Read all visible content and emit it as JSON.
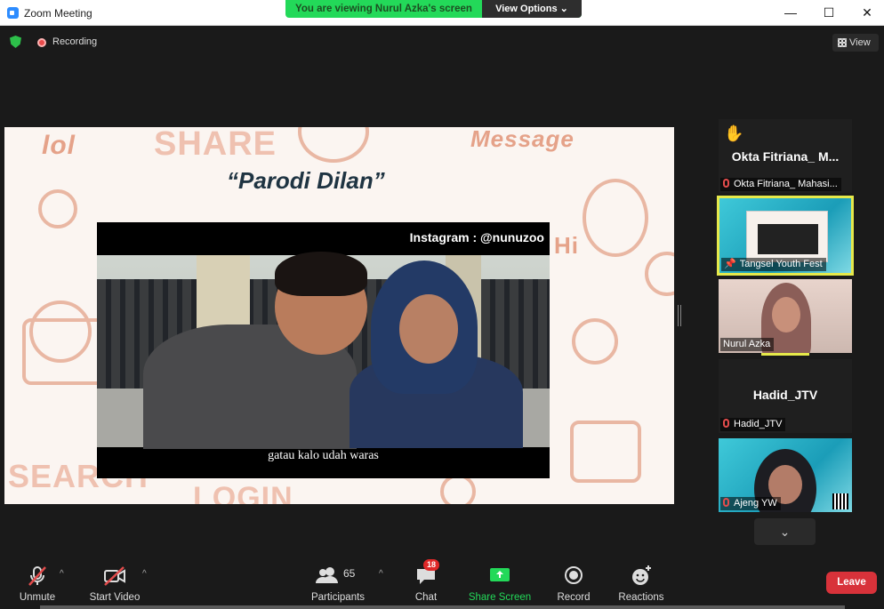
{
  "window": {
    "title": "Zoom Meeting"
  },
  "banner": {
    "text": "You are viewing Nurul Azka's screen",
    "options_label": "View Options"
  },
  "status": {
    "recording_label": "Recording",
    "view_label": "View"
  },
  "shared_screen": {
    "slide_title": "“Parodi Dilan”",
    "instagram": "Instagram : @nunuzoo",
    "caption": "gatau kalo udah waras",
    "doodles": [
      "lol",
      "SHARE",
      "Message",
      "Hi",
      "SEARCH",
      "LOGIN"
    ]
  },
  "participants": [
    {
      "display_name": "Okta  Fitriana_  M...",
      "label": "Okta Fitriana_ Mahasi...",
      "muted": true,
      "hand_raised": true
    },
    {
      "label": "Tangsel Youth Fest",
      "pinned": true,
      "active": true
    },
    {
      "label": "Nurul Azka",
      "muted": false
    },
    {
      "display_name": "Hadid_JTV",
      "label": "Hadid_JTV",
      "muted": true
    },
    {
      "label": "Ajeng YW",
      "muted": true
    }
  ],
  "toolbar": {
    "unmute": "Unmute",
    "start_video": "Start Video",
    "participants": "Participants",
    "participants_count": "65",
    "chat": "Chat",
    "chat_badge": "18",
    "share_screen": "Share Screen",
    "record": "Record",
    "reactions": "Reactions",
    "leave": "Leave"
  },
  "colors": {
    "share_green": "#23d959",
    "leave_red": "#d8323a",
    "active_border": "#e6e94a"
  }
}
